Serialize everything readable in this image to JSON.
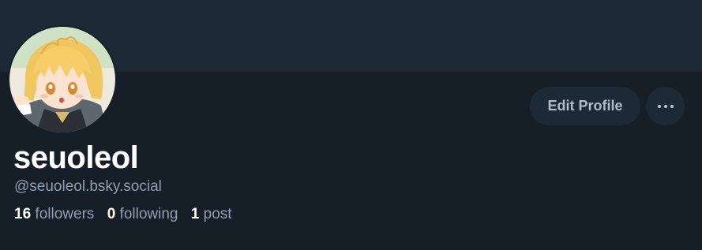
{
  "profile": {
    "display_name": "seuoleol",
    "handle": "@seuoleol.bsky.social",
    "avatar_alt": "anime character avatar"
  },
  "actions": {
    "edit_label": "Edit Profile",
    "more_icon": "ellipsis-horizontal-icon"
  },
  "stats": {
    "followers": {
      "count": "16",
      "label": "followers"
    },
    "following": {
      "count": "0",
      "label": "following"
    },
    "posts": {
      "count": "1",
      "label": "post"
    }
  },
  "colors": {
    "background": "#161e27",
    "banner": "#1e2936",
    "button_bg": "#1e2936",
    "button_text": "#aebbc9",
    "muted_text": "#8f9fb0",
    "primary_text": "#ffffff"
  }
}
